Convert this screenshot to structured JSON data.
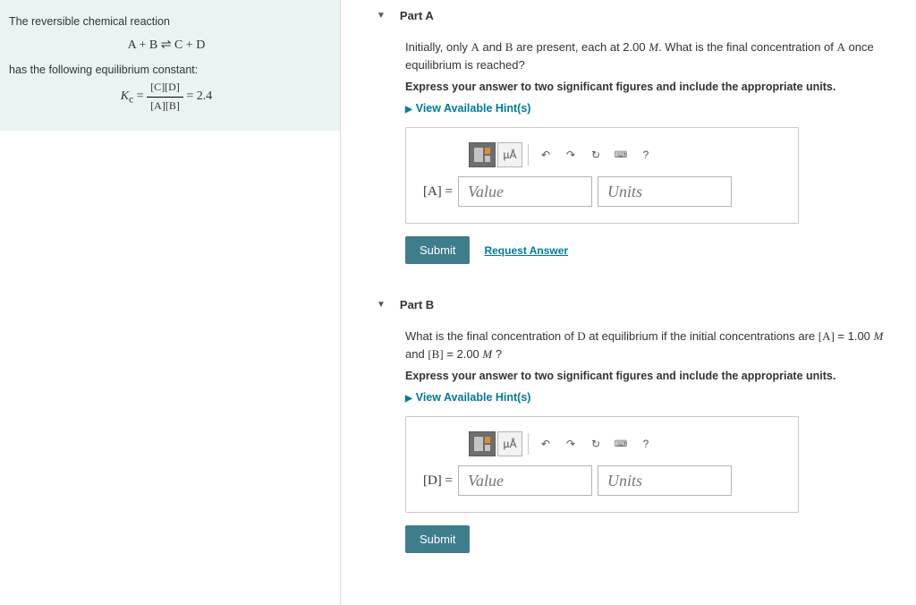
{
  "left": {
    "line1": "The reversible chemical reaction",
    "equation": "A + B ⇌ C + D",
    "line2": "has the following equilibrium constant:",
    "kc_prefix": "K",
    "kc_sub": "c",
    "kc_eq": " = ",
    "kc_num": "[C][D]",
    "kc_den": "[A][B]",
    "kc_val": " = 2.4"
  },
  "partA": {
    "title": "Part A",
    "prompt_before": "Initially, only ",
    "var1": "A",
    "prompt_and": " and ",
    "var2": "B",
    "prompt_mid": " are present, each at 2.00 ",
    "unitM": "M",
    "prompt_after": ". What is the final concentration of ",
    "var3": "A",
    "prompt_end": " once equilibrium is reached?",
    "instruction": "Express your answer to two significant figures and include the appropriate units.",
    "hints": "View Available Hint(s)",
    "units_label": "µÅ",
    "var_label": "[A] = ",
    "value_placeholder": "Value",
    "units_placeholder": "Units",
    "submit": "Submit",
    "request": "Request Answer",
    "help": "?"
  },
  "partB": {
    "title": "Part B",
    "prompt_before": "What is the final concentration of ",
    "varD": "D",
    "prompt_mid": " at equilibrium if the initial concentrations are ",
    "lblA": "[A]",
    "eqA": " = 1.00 ",
    "unitM": "M",
    "and": " and ",
    "lblB": "[B]",
    "eqB": " = 2.00 ",
    "qmark": " ?",
    "instruction": "Express your answer to two significant figures and include the appropriate units.",
    "hints": "View Available Hint(s)",
    "units_label": "µÅ",
    "var_label": "[D] = ",
    "value_placeholder": "Value",
    "units_placeholder": "Units",
    "submit": "Submit",
    "help": "?"
  }
}
